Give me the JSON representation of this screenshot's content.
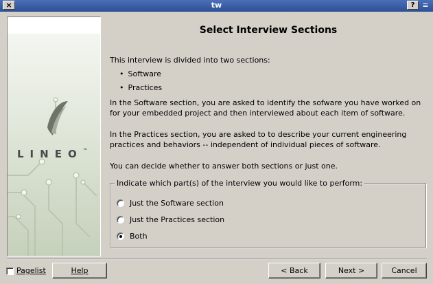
{
  "window": {
    "title": "tw",
    "close_glyph": "×",
    "help_glyph": "?",
    "menu_glyph": "≡"
  },
  "sidebar": {
    "logo_text": "LINEO",
    "logo_tm": "™"
  },
  "main": {
    "heading": "Select Interview Sections",
    "intro": "This interview is divided into two sections:",
    "bullets": [
      "Software",
      "Practices"
    ],
    "para_software": "In the Software section, you are asked to identify the sofware you have worked on for your embedded project and then interviewed about each item of software.",
    "para_practices": "In the Practices section, you are asked to to describe your current engineering practices and behaviors -- independent of individual pieces of software.",
    "para_choice": "You can decide whether to answer both sections or just one."
  },
  "options": {
    "legend": "Indicate which part(s) of the interview you would like to perform:",
    "items": [
      {
        "label": "Just the Software section",
        "selected": false
      },
      {
        "label": "Just the Practices section",
        "selected": false
      },
      {
        "label": "Both",
        "selected": true
      }
    ]
  },
  "footer": {
    "pagelist_label": "Pagelist",
    "pagelist_checked": false,
    "help_label": "Help",
    "back_label": "< Back",
    "next_label": "Next >",
    "cancel_label": "Cancel"
  },
  "colors": {
    "titlebar": "#3a5fa8",
    "dialog_bg": "#d4d0c8",
    "logo_gray": "#4a4a4a"
  }
}
